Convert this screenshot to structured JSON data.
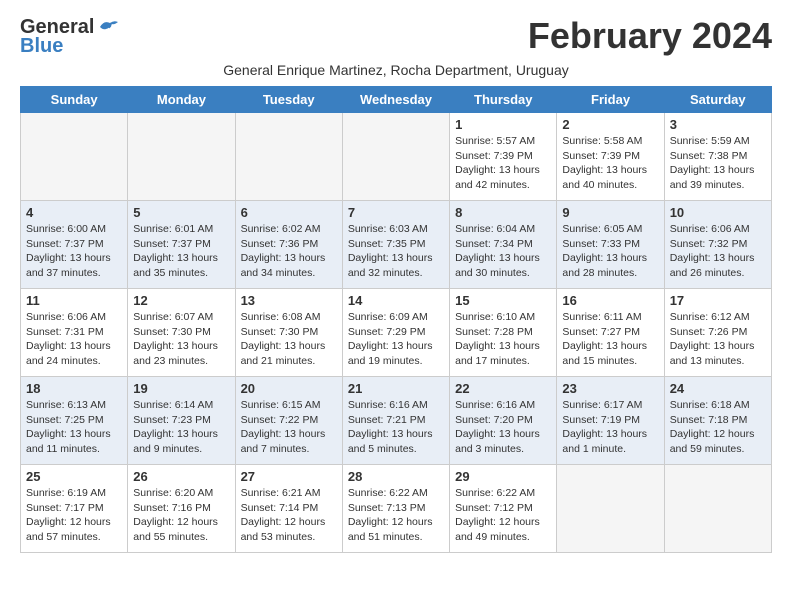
{
  "header": {
    "logo_general": "General",
    "logo_blue": "Blue",
    "month_title": "February 2024",
    "subtitle": "General Enrique Martinez, Rocha Department, Uruguay"
  },
  "days_of_week": [
    "Sunday",
    "Monday",
    "Tuesday",
    "Wednesday",
    "Thursday",
    "Friday",
    "Saturday"
  ],
  "weeks": [
    [
      {
        "day": "",
        "info": ""
      },
      {
        "day": "",
        "info": ""
      },
      {
        "day": "",
        "info": ""
      },
      {
        "day": "",
        "info": ""
      },
      {
        "day": "1",
        "info": "Sunrise: 5:57 AM\nSunset: 7:39 PM\nDaylight: 13 hours and 42 minutes."
      },
      {
        "day": "2",
        "info": "Sunrise: 5:58 AM\nSunset: 7:39 PM\nDaylight: 13 hours and 40 minutes."
      },
      {
        "day": "3",
        "info": "Sunrise: 5:59 AM\nSunset: 7:38 PM\nDaylight: 13 hours and 39 minutes."
      }
    ],
    [
      {
        "day": "4",
        "info": "Sunrise: 6:00 AM\nSunset: 7:37 PM\nDaylight: 13 hours and 37 minutes."
      },
      {
        "day": "5",
        "info": "Sunrise: 6:01 AM\nSunset: 7:37 PM\nDaylight: 13 hours and 35 minutes."
      },
      {
        "day": "6",
        "info": "Sunrise: 6:02 AM\nSunset: 7:36 PM\nDaylight: 13 hours and 34 minutes."
      },
      {
        "day": "7",
        "info": "Sunrise: 6:03 AM\nSunset: 7:35 PM\nDaylight: 13 hours and 32 minutes."
      },
      {
        "day": "8",
        "info": "Sunrise: 6:04 AM\nSunset: 7:34 PM\nDaylight: 13 hours and 30 minutes."
      },
      {
        "day": "9",
        "info": "Sunrise: 6:05 AM\nSunset: 7:33 PM\nDaylight: 13 hours and 28 minutes."
      },
      {
        "day": "10",
        "info": "Sunrise: 6:06 AM\nSunset: 7:32 PM\nDaylight: 13 hours and 26 minutes."
      }
    ],
    [
      {
        "day": "11",
        "info": "Sunrise: 6:06 AM\nSunset: 7:31 PM\nDaylight: 13 hours and 24 minutes."
      },
      {
        "day": "12",
        "info": "Sunrise: 6:07 AM\nSunset: 7:30 PM\nDaylight: 13 hours and 23 minutes."
      },
      {
        "day": "13",
        "info": "Sunrise: 6:08 AM\nSunset: 7:30 PM\nDaylight: 13 hours and 21 minutes."
      },
      {
        "day": "14",
        "info": "Sunrise: 6:09 AM\nSunset: 7:29 PM\nDaylight: 13 hours and 19 minutes."
      },
      {
        "day": "15",
        "info": "Sunrise: 6:10 AM\nSunset: 7:28 PM\nDaylight: 13 hours and 17 minutes."
      },
      {
        "day": "16",
        "info": "Sunrise: 6:11 AM\nSunset: 7:27 PM\nDaylight: 13 hours and 15 minutes."
      },
      {
        "day": "17",
        "info": "Sunrise: 6:12 AM\nSunset: 7:26 PM\nDaylight: 13 hours and 13 minutes."
      }
    ],
    [
      {
        "day": "18",
        "info": "Sunrise: 6:13 AM\nSunset: 7:25 PM\nDaylight: 13 hours and 11 minutes."
      },
      {
        "day": "19",
        "info": "Sunrise: 6:14 AM\nSunset: 7:23 PM\nDaylight: 13 hours and 9 minutes."
      },
      {
        "day": "20",
        "info": "Sunrise: 6:15 AM\nSunset: 7:22 PM\nDaylight: 13 hours and 7 minutes."
      },
      {
        "day": "21",
        "info": "Sunrise: 6:16 AM\nSunset: 7:21 PM\nDaylight: 13 hours and 5 minutes."
      },
      {
        "day": "22",
        "info": "Sunrise: 6:16 AM\nSunset: 7:20 PM\nDaylight: 13 hours and 3 minutes."
      },
      {
        "day": "23",
        "info": "Sunrise: 6:17 AM\nSunset: 7:19 PM\nDaylight: 13 hours and 1 minute."
      },
      {
        "day": "24",
        "info": "Sunrise: 6:18 AM\nSunset: 7:18 PM\nDaylight: 12 hours and 59 minutes."
      }
    ],
    [
      {
        "day": "25",
        "info": "Sunrise: 6:19 AM\nSunset: 7:17 PM\nDaylight: 12 hours and 57 minutes."
      },
      {
        "day": "26",
        "info": "Sunrise: 6:20 AM\nSunset: 7:16 PM\nDaylight: 12 hours and 55 minutes."
      },
      {
        "day": "27",
        "info": "Sunrise: 6:21 AM\nSunset: 7:14 PM\nDaylight: 12 hours and 53 minutes."
      },
      {
        "day": "28",
        "info": "Sunrise: 6:22 AM\nSunset: 7:13 PM\nDaylight: 12 hours and 51 minutes."
      },
      {
        "day": "29",
        "info": "Sunrise: 6:22 AM\nSunset: 7:12 PM\nDaylight: 12 hours and 49 minutes."
      },
      {
        "day": "",
        "info": ""
      },
      {
        "day": "",
        "info": ""
      }
    ]
  ]
}
